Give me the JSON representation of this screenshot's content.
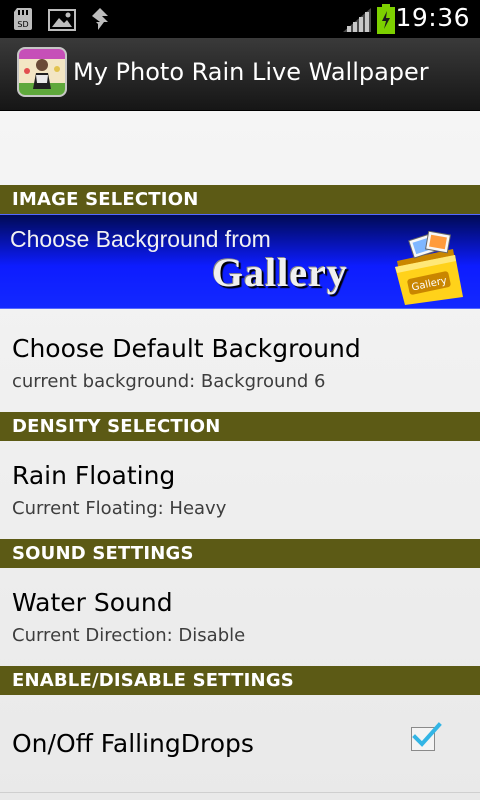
{
  "status_bar": {
    "time": "19:36",
    "icons": [
      "sd-card-icon",
      "image-notification-icon",
      "usb-debug-icon",
      "signal-icon",
      "battery-charging-icon"
    ]
  },
  "app_bar": {
    "title": "My Photo Rain Live Wallpaper",
    "icon": "app-photo-icon"
  },
  "sections": {
    "image_selection": {
      "header": "IMAGE SELECTION",
      "banner": {
        "line1": "Choose Background from",
        "line2": "Gallery",
        "badge": "Gallery"
      },
      "default_bg": {
        "title": "Choose Default Background",
        "summary": "current background: Background 6"
      }
    },
    "density": {
      "header": "DENSITY SELECTION",
      "rain": {
        "title": "Rain Floating",
        "summary": "Current Floating: Heavy"
      }
    },
    "sound": {
      "header": "SOUND SETTINGS",
      "water": {
        "title": "Water Sound",
        "summary": "Current Direction: Disable"
      }
    },
    "enable": {
      "header": "ENABLE/DISABLE SETTINGS",
      "drops": {
        "title": "On/Off FallingDrops",
        "checked": true
      }
    }
  },
  "colors": {
    "category_bg": "#5c5a15",
    "banner_blue": "#1329ff",
    "check_blue": "#33b5e5"
  }
}
